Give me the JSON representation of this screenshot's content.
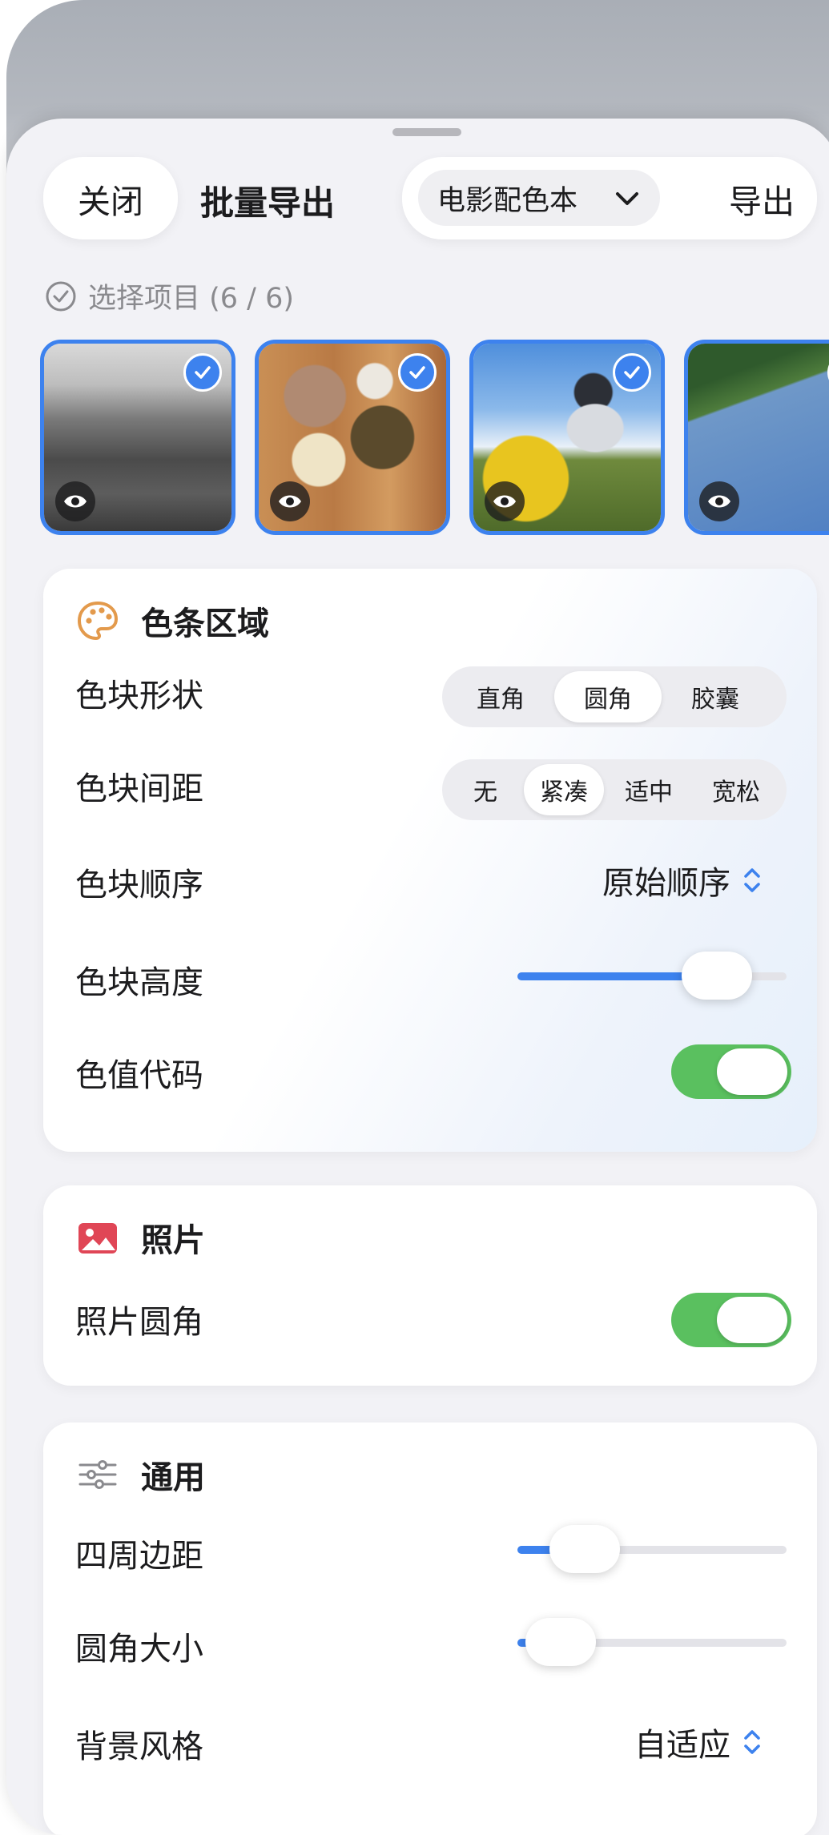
{
  "header": {
    "close_label": "关闭",
    "title": "批量导出",
    "preset_label": "电影配色本",
    "export_label": "导出"
  },
  "selection": {
    "label": "选择项目 (6 / 6)",
    "thumbnails": [
      {
        "name": "mountains-photo",
        "selected": true
      },
      {
        "name": "tea-table-photo",
        "selected": true
      },
      {
        "name": "motorcyclist-photo",
        "selected": true
      },
      {
        "name": "palm-sky-photo",
        "selected": true
      }
    ]
  },
  "color_strip": {
    "title": "色条区域",
    "icon": "palette-icon",
    "shape": {
      "label": "色块形状",
      "options": [
        "直角",
        "圆角",
        "胶囊"
      ],
      "selected": "圆角"
    },
    "spacing": {
      "label": "色块间距",
      "options": [
        "无",
        "紧凑",
        "适中",
        "宽松"
      ],
      "selected": "紧凑"
    },
    "order": {
      "label": "色块顺序",
      "value": "原始顺序"
    },
    "height": {
      "label": "色块高度",
      "value": 0.74
    },
    "codes": {
      "label": "色值代码",
      "on": true
    }
  },
  "photo": {
    "title": "照片",
    "icon": "photo-icon",
    "rounded": {
      "label": "照片圆角",
      "on": true
    }
  },
  "general": {
    "title": "通用",
    "icon": "sliders-icon",
    "padding": {
      "label": "四周边距",
      "value": 0.25
    },
    "corner": {
      "label": "圆角大小",
      "value": 0.16
    },
    "background": {
      "label": "背景风格",
      "value": "自适应"
    }
  },
  "colors": {
    "accent": "#3d82ee",
    "toggle_on": "#5ac05f",
    "palette_icon": "#e39a4c",
    "photo_icon": "#e04656"
  }
}
